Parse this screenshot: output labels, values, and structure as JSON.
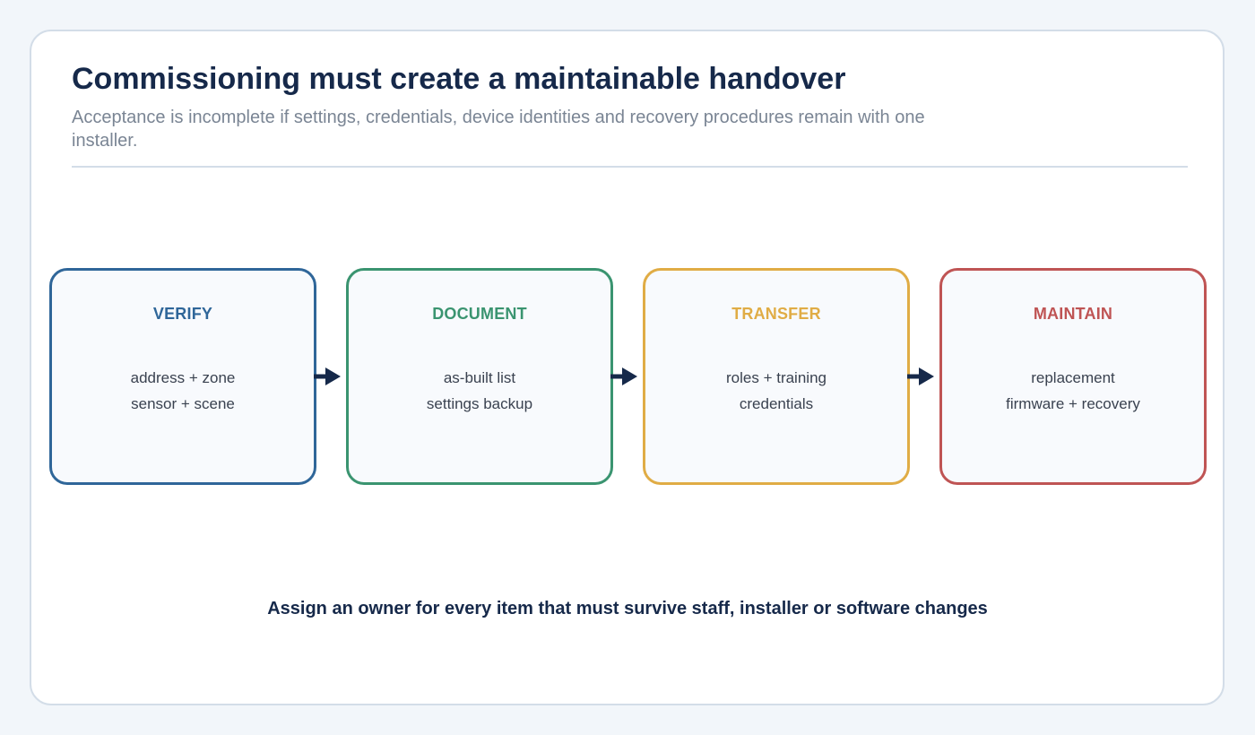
{
  "header": {
    "title": "Commissioning must create a maintainable handover",
    "subtitle": "Acceptance is incomplete if settings, credentials, device identities and recovery procedures remain with one installer."
  },
  "steps": [
    {
      "title": "VERIFY",
      "line1": "address + zone",
      "line2": "sensor + scene",
      "color": "#2f6699"
    },
    {
      "title": "DOCUMENT",
      "line1": "as-built list",
      "line2": "settings backup",
      "color": "#3a9470"
    },
    {
      "title": "TRANSFER",
      "line1": "roles + training",
      "line2": "credentials",
      "color": "#e0ac45"
    },
    {
      "title": "MAINTAIN",
      "line1": "replacement",
      "line2": "firmware + recovery",
      "color": "#bf5454"
    }
  ],
  "arrow_color": "#16294a",
  "footer": "Assign an owner for every item that must survive staff, installer or software changes"
}
